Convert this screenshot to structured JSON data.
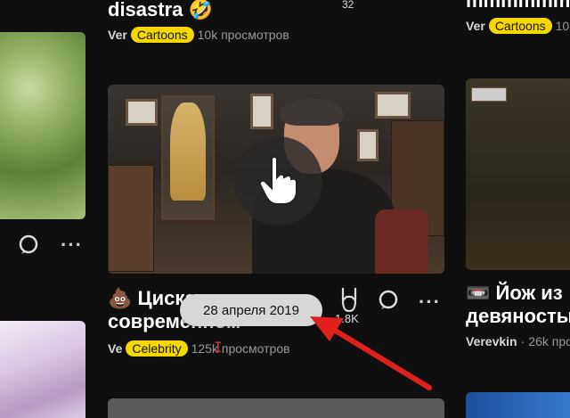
{
  "top_left_video": {
    "title": "disastra",
    "emoji": "🤣",
    "count": "32",
    "channel": "Ver",
    "tag": "Cartoons",
    "views": "10k просмотров"
  },
  "top_right_video": {
    "title": "mmmmmm",
    "channel": "Ver",
    "tag": "Cartoons",
    "views": "10k"
  },
  "main_video": {
    "emoji": "💩",
    "title_line1": "Цискаридзе о",
    "title_line2": "современном",
    "channel": "Ve",
    "tag": "Celebrity",
    "views": "125k просмотров",
    "likes": "1.8K"
  },
  "right_mid_video": {
    "emoji": "📼",
    "title_line1": "Йож из",
    "title_line2": "девяносты",
    "channel": "Verevkin",
    "views": "26k просм"
  },
  "tooltip": {
    "text": "28 апреля 2019"
  },
  "colors": {
    "background": "#0f0f0f",
    "tag": "#f5d800",
    "arrow": "#e0201c"
  }
}
